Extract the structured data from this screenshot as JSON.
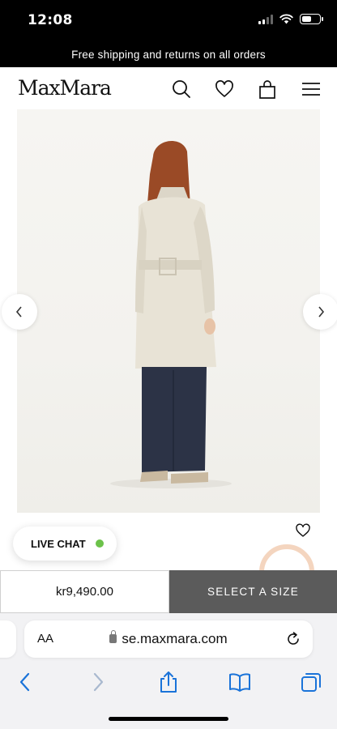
{
  "status_bar": {
    "time": "12:08"
  },
  "promo_banner": {
    "text": "Free shipping and returns on all orders"
  },
  "header": {
    "logo": "MaxMara"
  },
  "product": {
    "price": "kr9,490.00",
    "select_size_label": "SELECT A SIZE"
  },
  "live_chat": {
    "label": "LIVE CHAT"
  },
  "browser": {
    "text_size_label": "AA",
    "url": "se.maxmara.com"
  },
  "colors": {
    "black": "#000000",
    "button_gray": "#5b5b5b",
    "live_dot_green": "#6cc24a",
    "safari_bar": "#f2f2f4",
    "ios_blue": "#1a73d9"
  },
  "icons": [
    "search-icon",
    "heart-icon",
    "shopping-bag-icon",
    "menu-icon",
    "chevron-left-icon",
    "chevron-right-icon",
    "lock-icon",
    "reload-icon",
    "share-icon",
    "bookmarks-icon",
    "tabs-icon"
  ]
}
